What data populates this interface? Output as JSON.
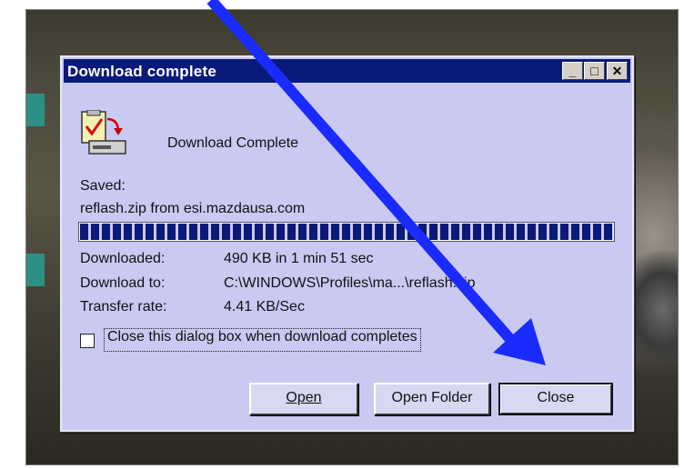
{
  "dialog": {
    "title": "Download complete",
    "status_heading": "Download Complete",
    "saved_label": "Saved:",
    "saved_file": "reflash.zip from esi.mazdausa.com",
    "progress_percent": 100,
    "rows": [
      {
        "label": "Downloaded:",
        "value": "490 KB in 1 min 51 sec"
      },
      {
        "label": "Download to:",
        "value": "C:\\WINDOWS\\Profiles\\ma...\\reflash.zip"
      },
      {
        "label": "Transfer rate:",
        "value": "4.41 KB/Sec"
      }
    ],
    "checkbox_label": "Close this dialog box when download completes",
    "checkbox_checked": false,
    "buttons": {
      "open": "Open",
      "open_folder": "Open Folder",
      "close": "Close"
    },
    "window_controls": {
      "minimize": "_",
      "maximize": "□",
      "close": "✕"
    }
  },
  "annotation": {
    "arrow_color": "#1a2bff",
    "points_to": "close-button"
  },
  "colors": {
    "titlebar": "#0a1a7a",
    "dialog_bg": "#c9c9f2",
    "progress": "#0a1a7a"
  }
}
